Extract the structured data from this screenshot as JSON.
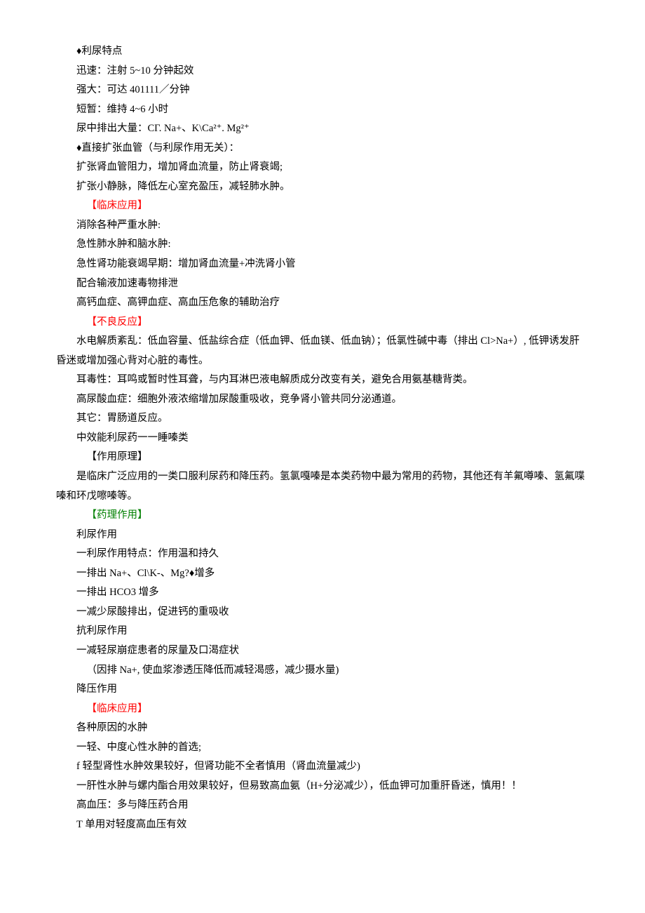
{
  "lines": [
    {
      "text": "♦利尿特点",
      "cls": ""
    },
    {
      "text": "迅速：注射 5~10 分钟起效",
      "cls": ""
    },
    {
      "text": "强大：可达 401111／分钟",
      "cls": ""
    },
    {
      "text": "短暂：维持 4~6 小时",
      "cls": ""
    },
    {
      "text": "尿中排出大量：CΓ. Na+、K\\Ca²⁺. Mg²⁺",
      "cls": ""
    },
    {
      "text": "♦直接扩张血管（与利尿作用无关）：",
      "cls": ""
    },
    {
      "text": "扩张肾血管阻力，增加肾血流量，防止肾衰竭;",
      "cls": ""
    },
    {
      "text": "扩张小静脉，降低左心室充盈压，减轻肺水肿。",
      "cls": ""
    },
    {
      "text": "【临床应用】",
      "cls": "indent3 red"
    },
    {
      "text": "消除各种严重水肿:",
      "cls": ""
    },
    {
      "text": "急性肺水肿和脑水肿:",
      "cls": ""
    },
    {
      "text": "急性肾功能衰竭早期：增加肾血流量+冲洗肾小管",
      "cls": ""
    },
    {
      "text": "配合输液加速毒物排泄",
      "cls": ""
    },
    {
      "text": "高钙血症、高钾血症、高血压危象的辅助治疗",
      "cls": ""
    },
    {
      "text": "【不良反应】",
      "cls": "indent3 red"
    },
    {
      "text": "水电解质紊乱：低血容量、低盐综合症（低血钾、低血镁、低血钠）；低氯性碱中毒（排出 Cl>Na+）, 低钾诱发肝昏迷或增加强心背对心脏的毒性。",
      "cls": "",
      "wrap": true
    },
    {
      "text": "耳毒性：耳鸣或暂时性耳聋，与内耳淋巴液电解质成分改变有关，避免合用氨基糖背类。",
      "cls": ""
    },
    {
      "text": "高尿酸血症：细胞外液浓缩增加尿酸重吸收，竞争肾小管共同分泌通道。",
      "cls": ""
    },
    {
      "text": "其它：胃肠道反应。",
      "cls": ""
    },
    {
      "text": "中效能利尿药一一睡嗪类",
      "cls": ""
    },
    {
      "text": "【作用原理】",
      "cls": "indent3"
    },
    {
      "text": "是临床广泛应用的一类口服利尿药和降压药。氢氯嘎嗪是本类药物中最为常用的药物，其他还有羊氟噂嗪、氢氟喋嗪和环戊嚓嗪等。",
      "cls": "",
      "wrap": true
    },
    {
      "text": "【药理作用】",
      "cls": "indent3 green"
    },
    {
      "text": "利尿作用",
      "cls": ""
    },
    {
      "text": "一利尿作用特点：作用温和持久",
      "cls": ""
    },
    {
      "text": "一排出 Na+、Cl\\K-、Mg?♦增多",
      "cls": ""
    },
    {
      "text": "一排出 HCO3 增多",
      "cls": ""
    },
    {
      "text": "一减少尿酸排出，促进钙的重吸收",
      "cls": ""
    },
    {
      "text": "抗利尿作用",
      "cls": ""
    },
    {
      "text": "一减轻尿崩症患者的尿量及口渴症状",
      "cls": ""
    },
    {
      "text": "（因排 Na+, 使血浆渗透压降低而减轻渴感，减少摄水量)",
      "cls": "indent3"
    },
    {
      "text": "降压作用",
      "cls": ""
    },
    {
      "text": "【临床应用】",
      "cls": "indent3 red"
    },
    {
      "text": "各种原因的水肿",
      "cls": ""
    },
    {
      "text": "一轻、中度心性水肿的首选;",
      "cls": ""
    },
    {
      "text": " ",
      "cls": ""
    },
    {
      "text": "f 轻型肾性水肿效果较好，但肾功能不全者慎用（肾血流量减少)",
      "cls": ""
    },
    {
      "text": "一肝性水肿与螺内酯合用效果较好，但易致高血氨（H+分泌减少），低血钾可加重肝昏迷，慎用！！",
      "cls": ""
    },
    {
      "text": "高血压：多与降压药合用",
      "cls": ""
    },
    {
      "text": "T 单用对轻度高血压有效",
      "cls": ""
    }
  ]
}
